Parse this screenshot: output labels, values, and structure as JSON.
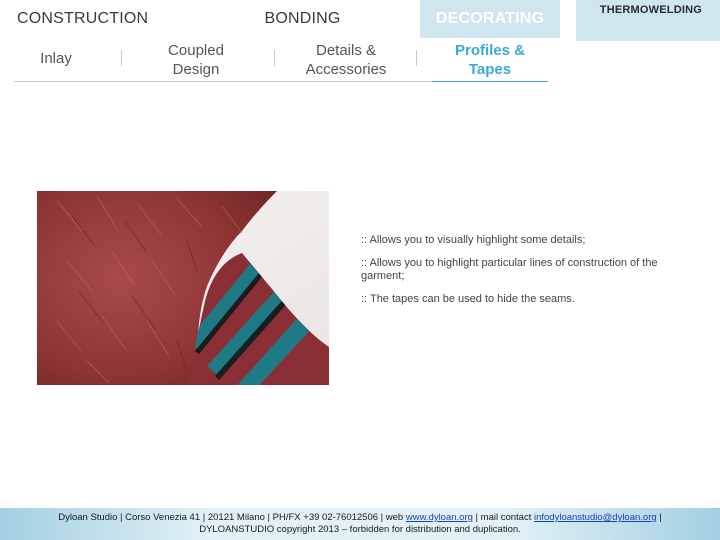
{
  "tabs": {
    "construction": "CONSTRUCTION",
    "bonding": "BONDING",
    "decorating": "DECORATING",
    "thermowelding": "THERMOWELDING"
  },
  "subnav": {
    "inlay": "Inlay",
    "coupled_line1": "Coupled",
    "coupled_line2": "Design",
    "details_line1": "Details &",
    "details_line2": "Accessories",
    "profiles_line1": "Profiles &",
    "profiles_line2": "Tapes",
    "separator": "|"
  },
  "content": {
    "bullets": [
      ":: Allows you to visually highlight  some details;",
      ":: Allows you to highlight particular lines of construction of the garment;",
      ":: The tapes can be used to hide the seams."
    ]
  },
  "footer": {
    "line1_prefix": "Dyloan Studio | Corso Venezia 41 | 20121 Milano | PH/FX +39 02-76012506 | web ",
    "web_link": "www.dyloan.org",
    "line1_mid": " | mail contact ",
    "mail_link": "infodyloanstudio@dyloan.org",
    "line1_suffix": " |",
    "line2": "DYLOANSTUDIO copyright 2013 – forbidden for distribution and duplication."
  },
  "colors": {
    "active_tab_bg": "#cfe6ef",
    "active_subnav": "#3ba9d8",
    "fur": "#9c3c3c",
    "stripe_teal": "#1f7a86"
  }
}
